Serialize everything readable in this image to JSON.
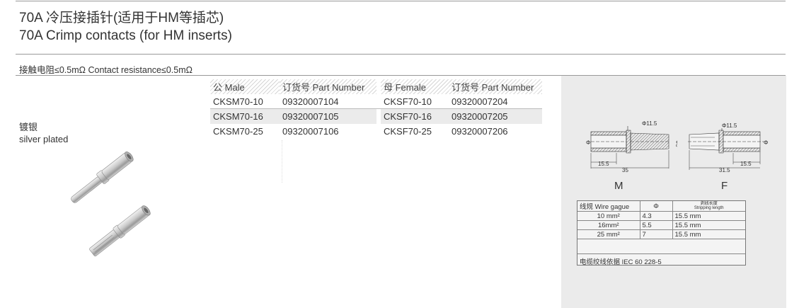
{
  "title": {
    "zh": "70A 冷压接插针(适用于HM等插芯)",
    "en": "70A Crimp contacts (for HM inserts)"
  },
  "contact_resistance": "接触电阻≤0.5mΩ Contact resistance≤0.5mΩ",
  "plating": {
    "zh": "镀银",
    "en": "silver plated"
  },
  "table": {
    "headers": [
      "公 Male",
      "订货号 Part Number",
      "母 Female",
      "订货号 Part Number"
    ],
    "rows": [
      [
        "CKSM70-10",
        "09320007104",
        "CKSF70-10",
        "09320007204"
      ],
      [
        "CKSM70-16",
        "09320007105",
        "CKSF70-16",
        "09320007205"
      ],
      [
        "CKSM70-25",
        "09320007106",
        "CKSF70-25",
        "09320007206"
      ]
    ]
  },
  "drawing": {
    "male": {
      "label": "M",
      "dim_flange": "Φ11.5",
      "dim_side": "Φ6",
      "dim_left": "Φ",
      "dim_strip": "15.5",
      "dim_total": "35"
    },
    "female": {
      "label": "F",
      "dim_flange": "Φ11.5",
      "dim_right": "Φ",
      "dim_strip": "15.5",
      "dim_total": "31.5"
    }
  },
  "wire_table": {
    "headers": [
      "线规 Wire gague",
      "Φ",
      "剥线长度",
      "Stripping length"
    ],
    "rows": [
      [
        "10 mm²",
        "4.3",
        "15.5 mm"
      ],
      [
        "16mm²",
        "5.5",
        "15.5 mm"
      ],
      [
        "25 mm²",
        "7",
        "15.5 mm"
      ]
    ],
    "note": "电缆绞线依据 IEC 60 228-5"
  },
  "colors": {
    "text": "#333333",
    "rule": "#999999",
    "panel": "#ebebeb",
    "row_shade": "#ebebeb",
    "metal": "#c8c8c8"
  }
}
